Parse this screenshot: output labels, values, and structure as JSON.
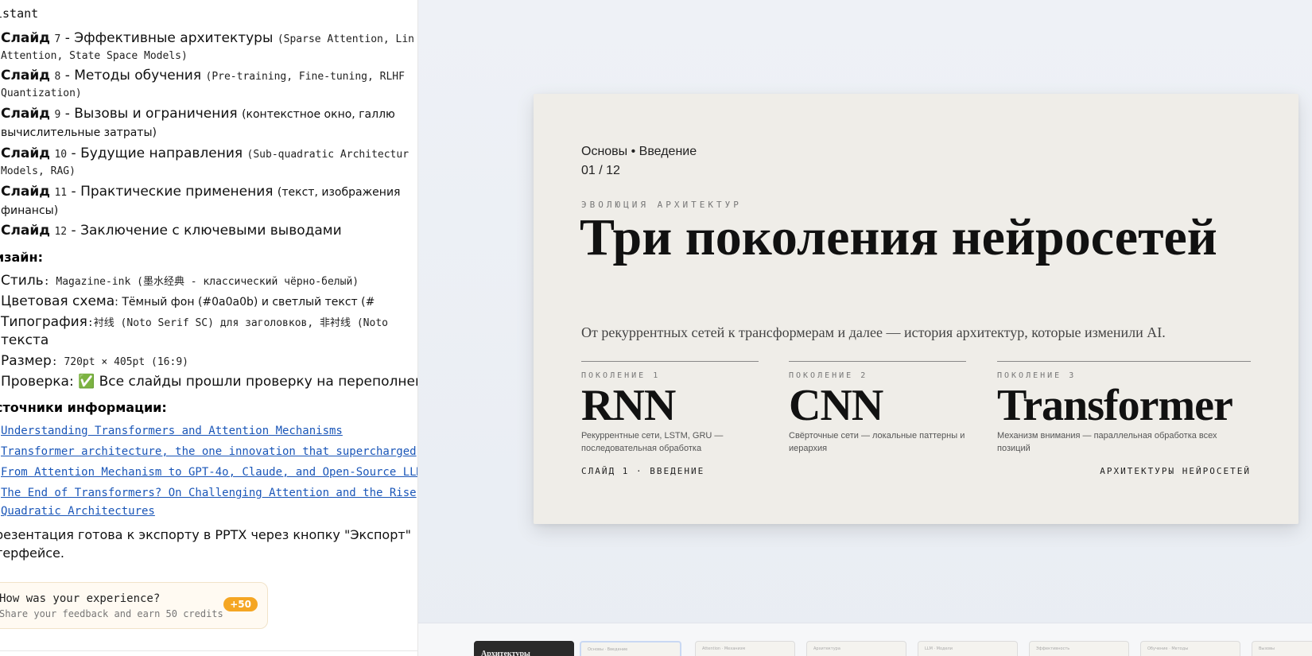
{
  "chat": {
    "header": "istant",
    "slides": [
      {
        "label": "Слайд",
        "num": "7",
        "dash": "-",
        "title": "Эффективные архитектуры",
        "detail": "(Sparse Attention, Lin",
        "cont": "Attention, State Space Models)"
      },
      {
        "label": "Слайд",
        "num": "8",
        "dash": "-",
        "title": "Методы обучения",
        "detail": "(Pre-training, Fine-tuning, RLHF",
        "cont": "Quantization)"
      },
      {
        "label": "Слайд",
        "num": "9",
        "dash": "-",
        "title": "Вызовы и ограничения",
        "detail": "(контекстное окно, галлю",
        "cont": "вычислительные затраты)"
      },
      {
        "label": "Слайд",
        "num": "10",
        "dash": "-",
        "title": "Будущие направления",
        "detail": "(Sub-quadratic Architectur",
        "cont": "Models, RAG)"
      },
      {
        "label": "Слайд",
        "num": "11",
        "dash": "-",
        "title": "Практические применения",
        "detail": "(текст, изображения",
        "cont": "финансы)"
      },
      {
        "label": "Слайд",
        "num": "12",
        "dash": "-",
        "title": "Заключение с ключевыми выводами",
        "detail": "",
        "cont": ""
      }
    ],
    "design_heading": "изайн:",
    "design": [
      {
        "k": "Стиль",
        "v": ": Magazine-ink (墨水经典 - классический чёрно-белый)"
      },
      {
        "k": "Цветовая схема",
        "v": ": Тёмный фон (#0a0a0b) и светлый текст (#"
      },
      {
        "k": "Типография",
        "v": ":衬线 (Noto Serif SC) для заголовков, 非衬线 (Noto",
        "cont": "текста"
      },
      {
        "k": "Размер",
        "v": ": 720pt × 405pt (16:9)"
      },
      {
        "k": "Проверка",
        "v": ": ✅ Все слайды прошли проверку на переполнен"
      }
    ],
    "sources_heading": "сточники информации:",
    "sources": [
      "Understanding Transformers and Attention Mechanisms",
      "Transformer architecture, the one innovation that supercharged",
      "From Attention Mechanism to GPT-4o, Claude, and Open-Source LLM",
      "The End of Transformers? On Challenging Attention and the Rise",
      "Quadratic Architectures"
    ],
    "export_line1": "резентация готова к экспорту в PPTX через кнопку \"Экспорт\"",
    "export_line2": "терфейсе.",
    "feedback": {
      "title": "How was your experience?",
      "subtitle": "Share your feedback and earn 50 credits",
      "badge": "+50"
    }
  },
  "slide": {
    "kicker": "Основы • Введение",
    "page": "01 / 12",
    "eyebrow": "ЭВОЛЮЦИЯ АРХИТЕКТУР",
    "title": "Три поколения нейросетей",
    "subtitle": "От рекуррентных сетей к трансформерам и далее — история архитектур, которые изменили AI.",
    "generations": [
      {
        "label": "ПОКОЛЕНИЕ 1",
        "name": "RNN",
        "desc": "Рекуррентные сети, LSTM, GRU — последовательная обработка"
      },
      {
        "label": "ПОКОЛЕНИЕ 2",
        "name": "CNN",
        "desc": "Свёрточные сети — локальные паттерны и иерархия"
      },
      {
        "label": "ПОКОЛЕНИЕ 3",
        "name": "Transformer",
        "desc": "Механизм внимания — параллельная обработка всех позиций"
      }
    ],
    "footer_left": "СЛАЙД 1 · ВВЕДЕНИЕ",
    "footer_right": "АРХИТЕКТУРЫ НЕЙРОСЕТЕЙ"
  },
  "thumbnails": [
    {
      "label": "Архитектуры"
    },
    {
      "label": "Основы · Введение"
    },
    {
      "label": "Attention · Механизм"
    },
    {
      "label": "Архитектура"
    },
    {
      "label": "LLM · Модели"
    },
    {
      "label": "Эффективность"
    },
    {
      "label": "Обучение · Методы"
    },
    {
      "label": "Вызовы"
    }
  ]
}
